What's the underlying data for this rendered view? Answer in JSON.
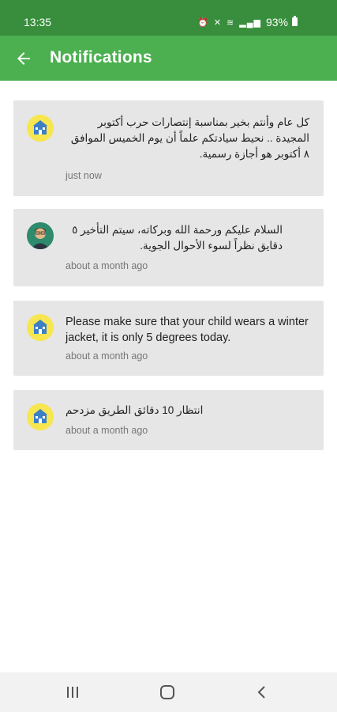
{
  "status_bar": {
    "time": "13:35",
    "icons": [
      "alarm-icon",
      "mute-icon",
      "wifi-icon",
      "signal-icon"
    ],
    "battery": "93%"
  },
  "app_bar": {
    "title": "Notifications",
    "back_icon": "arrow-left-icon"
  },
  "notifications": [
    {
      "avatar": "school-icon",
      "message": "كل عام وأنتم بخير بمناسبة إنتصارات حرب أكتوبر المجيدة .. نحيط سيادتكم علماً أن يوم الخميس الموافق ٨ أكتوبر هو أجازة رسمية.",
      "time": "just now"
    },
    {
      "avatar": "person-icon",
      "message": "السلام عليكم ورحمة الله وبركاته، سيتم التأخير ٥ دقايق نظراً لسوء الأحوال الجوية.",
      "time": "about a month ago"
    },
    {
      "avatar": "school-icon",
      "message": "Please make sure that your child wears a winter jacket, it is only 5 degrees today.",
      "time": "about a month ago"
    },
    {
      "avatar": "school-icon",
      "message": "انتظار 10 دقائق الطريق مزدحم",
      "time": "about a month ago"
    }
  ],
  "nav_bar": {
    "buttons": [
      "recent-apps-icon",
      "home-icon",
      "back-icon"
    ]
  },
  "colors": {
    "status_bar": "#388e3c",
    "app_bar": "#4caf50",
    "card": "#e6e6e6"
  }
}
